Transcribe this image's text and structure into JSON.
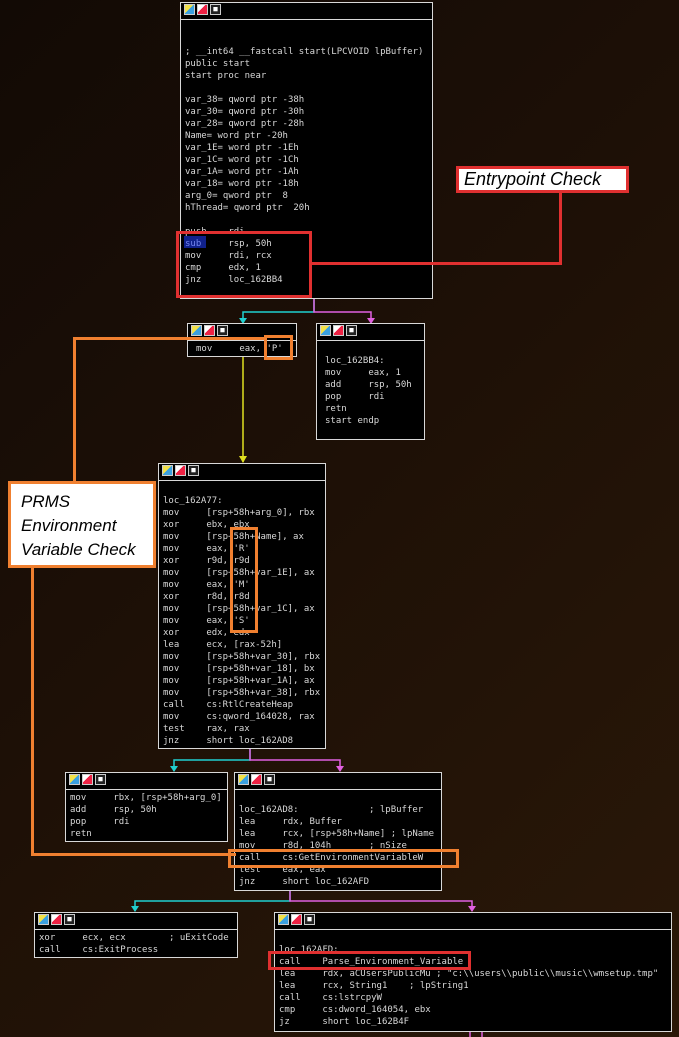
{
  "callouts": {
    "entrypoint": "Entrypoint Check",
    "prms": [
      "PRMS",
      "Environment",
      "Variable Check"
    ]
  },
  "nodes": {
    "start": {
      "lines": [
        "",
        "",
        "; __int64 __fastcall start(LPCVOID lpBuffer)",
        "public start",
        "start proc near",
        "",
        "var_38= qword ptr -38h",
        "var_30= qword ptr -30h",
        "var_28= qword ptr -28h",
        "Name= word ptr -20h",
        "var_1E= word ptr -1Eh",
        "var_1C= word ptr -1Ch",
        "var_1A= word ptr -1Ah",
        "var_18= word ptr -18h",
        "arg_0= qword ptr  8",
        "hThread= qword ptr  20h",
        "",
        "push    rdi",
        "sub     rsp, 50h",
        "mov     rdi, rcx",
        "cmp     edx, 1",
        "jnz     loc_162BB4"
      ]
    },
    "mov_p": {
      "lines": [
        "mov     eax, 'P'"
      ]
    },
    "loc_162bb4": {
      "lines": [
        "",
        "loc_162BB4:",
        "mov     eax, 1",
        "add     rsp, 50h",
        "pop     rdi",
        "retn",
        "start endp"
      ]
    },
    "loc_162a77": {
      "lines": [
        "",
        "loc_162A77:",
        "mov     [rsp+58h+arg_0], rbx",
        "xor     ebx, ebx",
        "mov     [rsp+58h+Name], ax",
        "mov     eax, 'R'",
        "xor     r9d, r9d",
        "mov     [rsp+58h+var_1E], ax",
        "mov     eax, 'M'",
        "xor     r8d, r8d",
        "mov     [rsp+58h+var_1C], ax",
        "mov     eax, 'S'",
        "xor     edx, edx",
        "lea     ecx, [rax-52h]",
        "mov     [rsp+58h+var_30], rbx",
        "mov     [rsp+58h+var_18], bx",
        "mov     [rsp+58h+var_1A], ax",
        "mov     [rsp+58h+var_38], rbx",
        "call    cs:RtlCreateHeap",
        "mov     cs:qword_164028, rax",
        "test    rax, rax",
        "jnz     short loc_162AD8"
      ]
    },
    "cleanup": {
      "lines": [
        "mov     rbx, [rsp+58h+arg_0]",
        "add     rsp, 50h",
        "pop     rdi",
        "retn"
      ]
    },
    "loc_162ad8": {
      "lines": [
        "",
        "loc_162AD8:             ; lpBuffer",
        "lea     rdx, Buffer",
        "lea     rcx, [rsp+58h+Name] ; lpName",
        "mov     r8d, 104h       ; nSize",
        "call    cs:GetEnvironmentVariableW",
        "test    eax, eax",
        "jnz     short loc_162AFD"
      ]
    },
    "exit": {
      "lines": [
        "xor     ecx, ecx        ; uExitCode",
        "call    cs:ExitProcess"
      ]
    },
    "loc_162afd": {
      "lines": [
        "",
        "loc_162AFD:",
        "call    Parse_Environment_Variable",
        "lea     rdx, aCUsersPublicMu ; \"c:\\\\users\\\\public\\\\music\\\\wmsetup.tmp\"",
        "lea     rcx, String1    ; lpString1",
        "call    cs:lstrcpyW",
        "cmp     cs:dword_164054, ebx",
        "jz      short loc_162B4F"
      ]
    }
  }
}
